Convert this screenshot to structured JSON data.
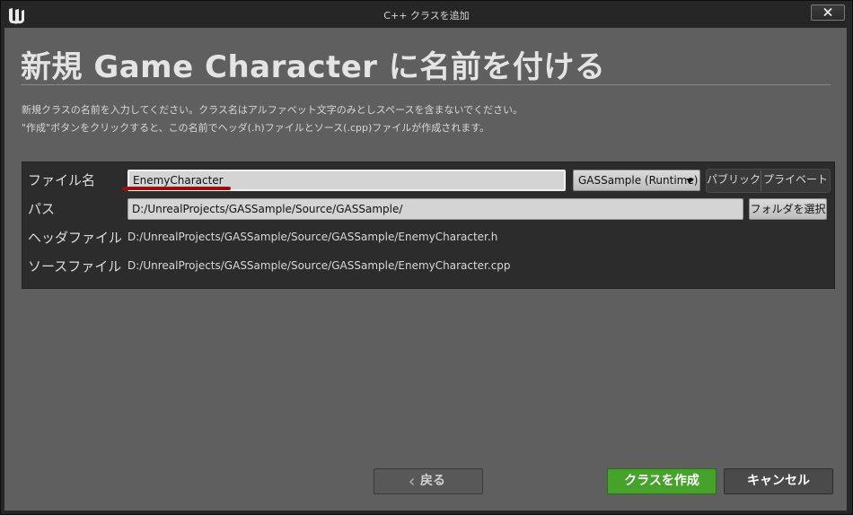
{
  "window": {
    "title": "C++ クラスを追加"
  },
  "heading": "新規 Game Character に名前を付ける",
  "description": {
    "line1": "新規クラスの名前を入力してください。クラス名はアルファベット文字のみとしスペースを含まないでください。",
    "line2": "\"作成\"ボタンをクリックすると、この名前でヘッダ(.h)ファイルとソース(.cpp)ファイルが作成されます。"
  },
  "form": {
    "name_label": "ファイル名",
    "name_value": "EnemyCharacter",
    "module_select": "GASSample (Runtime)",
    "visibility": {
      "public_label": "パブリック",
      "private_label": "プライベート"
    },
    "path_label": "パス",
    "path_value": "D:/UnrealProjects/GASSample/Source/GASSample/",
    "choose_folder_label": "フォルダを選択",
    "header_label": "ヘッダファイル",
    "header_value": "D:/UnrealProjects/GASSample/Source/GASSample/EnemyCharacter.h",
    "source_label": "ソースファイル",
    "source_value": "D:/UnrealProjects/GASSample/Source/GASSample/EnemyCharacter.cpp"
  },
  "footer": {
    "back_label": "戻る",
    "create_label": "クラスを作成",
    "cancel_label": "キャンセル"
  },
  "colors": {
    "accent_create": "#46a22b",
    "name_underline": "#9a1010"
  },
  "icons": {
    "logo": "unreal-engine-logo",
    "close": "close-icon",
    "dropdown": "caret-down-icon",
    "back": "chevron-left-icon"
  }
}
